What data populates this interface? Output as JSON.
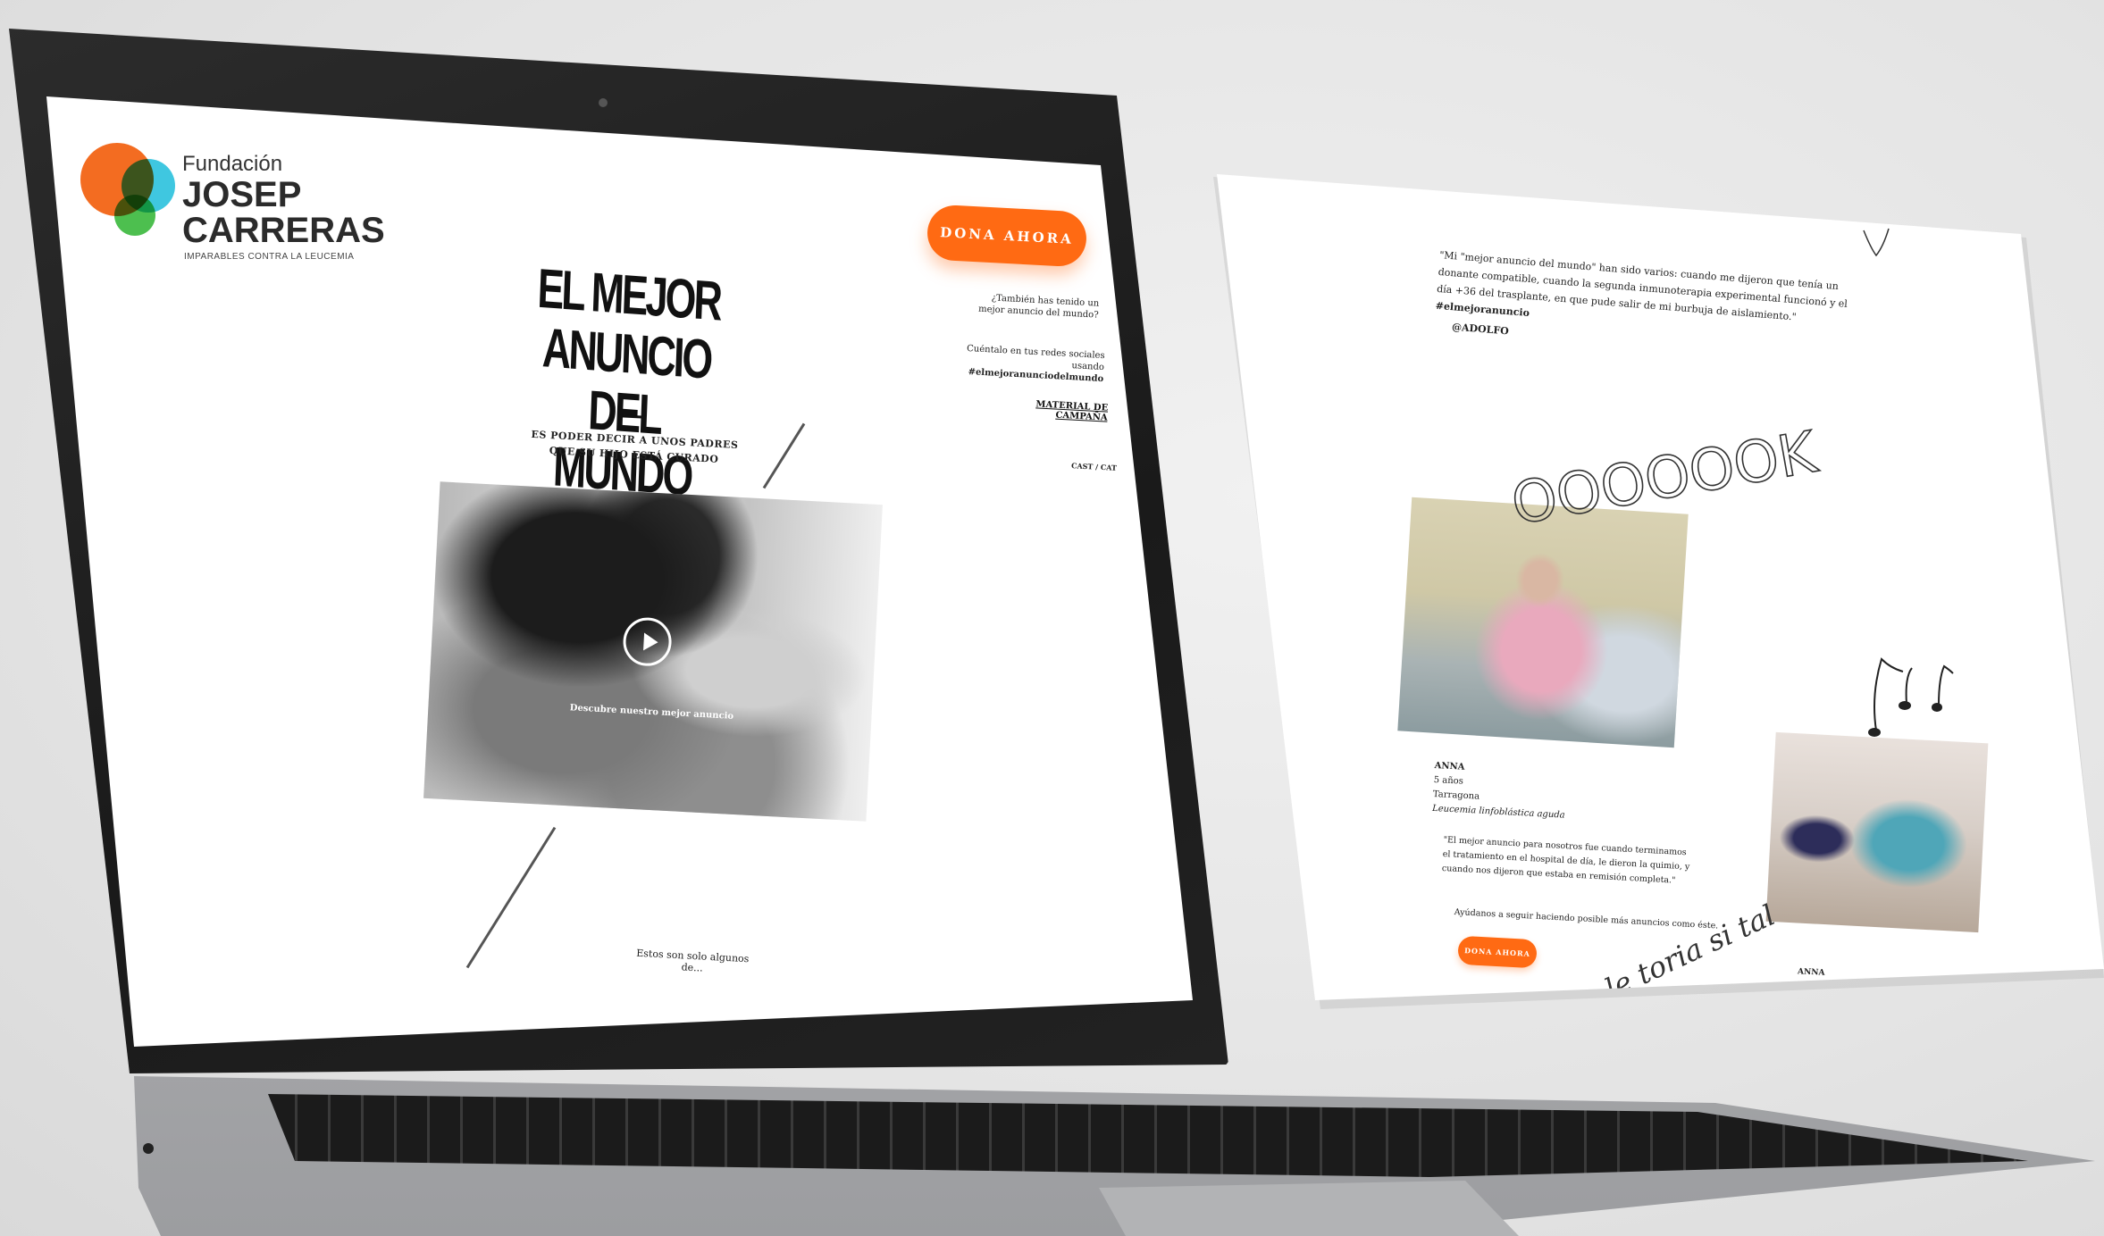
{
  "logo": {
    "top": "Fundación",
    "main": "JOSEP CARRERAS",
    "tagline": "IMPARABLES CONTRA LA LEUCEMIA"
  },
  "header": {
    "donate_label": "DONA AHORA",
    "side_question": "¿También has tenido un mejor anuncio del mundo?",
    "side_cta": "Cuéntalo en tus redes sociales usando",
    "side_hashtag": "#elmejoranunciodelmundo",
    "material_link": "MATERIAL DE CAMPAÑA",
    "lang": "CAST / CAT"
  },
  "hero": {
    "title": "EL MEJOR ANUNCIO DEL MUNDO",
    "subtitle": "ES PODER DECIR A UNOS PADRES QUE SU HIJO ESTÁ CURADO",
    "video_caption": "Descubre nuestro mejor anuncio",
    "footer_note": "Estos son solo algunos de..."
  },
  "panel": {
    "quote": "\"Mi \"mejor anuncio del mundo\" han sido varios: cuando me dijeron que tenía un donante compatible, cuando la segunda inmunoterapia experimental funcionó y el día +36 del trasplante, en que pude salir de mi burbuja de aislamiento.\"",
    "quote_hashtag": "#elmejoranuncio",
    "handle": "@ADOLFO",
    "doodle_text": "OOOOOOK",
    "story": {
      "name": "ANNA",
      "age": "5 años",
      "city": "Tarragona",
      "diagnosis": "Leucemia linfoblástica aguda",
      "quote": "\"El mejor anuncio para nosotros fue cuando terminamos el tratamiento en el hospital de día, le dieron la quimio, y cuando nos dijeron que estaba en remisión completa.\""
    },
    "help_text": "Ayúdanos a seguir haciendo posible más anuncios como éste.",
    "donate_label": "DONA AHORA",
    "second_name": "ANNA",
    "scribble": "le toria si tal"
  },
  "colors": {
    "accent": "#ff6a13",
    "logo_orange": "#f36c21",
    "logo_blue": "#3fc7e0",
    "logo_green": "#4dbf4f"
  }
}
